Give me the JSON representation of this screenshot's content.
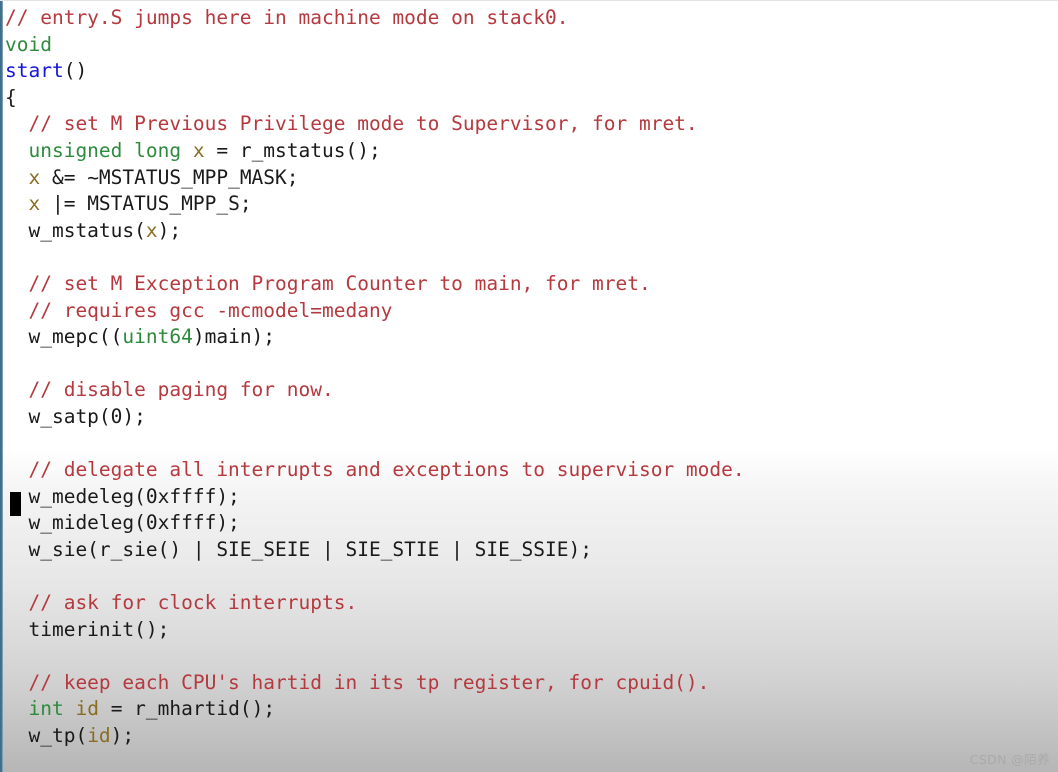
{
  "editor": {
    "language": "C",
    "colors": {
      "comment": "#b5393f",
      "type_keyword": "#2e8b3e",
      "function_name": "#1414dc",
      "variable": "#8a6d23",
      "plain_text": "#1a1a1a",
      "background_top": "#ffffff",
      "background_bottom": "#b6b6b6",
      "left_border": "#3d6b8a",
      "cursor": "#000000"
    },
    "cursor": {
      "shape": "block",
      "line_index": 18,
      "column": 0
    },
    "lines": [
      {
        "n": 1,
        "tokens": [
          {
            "t": "comment",
            "s": "// entry.S jumps here in machine mode on stack0."
          }
        ]
      },
      {
        "n": 2,
        "tokens": [
          {
            "t": "type",
            "s": "void"
          }
        ]
      },
      {
        "n": 3,
        "tokens": [
          {
            "t": "fn",
            "s": "start"
          },
          {
            "t": "plain",
            "s": "()"
          }
        ]
      },
      {
        "n": 4,
        "tokens": [
          {
            "t": "plain",
            "s": "{"
          }
        ]
      },
      {
        "n": 5,
        "tokens": [
          {
            "t": "comment",
            "s": "  // set M Previous Privilege mode to Supervisor, for mret."
          }
        ]
      },
      {
        "n": 6,
        "tokens": [
          {
            "t": "plain",
            "s": "  "
          },
          {
            "t": "type",
            "s": "unsigned long"
          },
          {
            "t": "plain",
            "s": " "
          },
          {
            "t": "var",
            "s": "x"
          },
          {
            "t": "plain",
            "s": " = r_mstatus();"
          }
        ]
      },
      {
        "n": 7,
        "tokens": [
          {
            "t": "plain",
            "s": "  "
          },
          {
            "t": "var",
            "s": "x"
          },
          {
            "t": "plain",
            "s": " &= ~MSTATUS_MPP_MASK;"
          }
        ]
      },
      {
        "n": 8,
        "tokens": [
          {
            "t": "plain",
            "s": "  "
          },
          {
            "t": "var",
            "s": "x"
          },
          {
            "t": "plain",
            "s": " |= MSTATUS_MPP_S;"
          }
        ]
      },
      {
        "n": 9,
        "tokens": [
          {
            "t": "plain",
            "s": "  w_mstatus("
          },
          {
            "t": "var",
            "s": "x"
          },
          {
            "t": "plain",
            "s": ");"
          }
        ]
      },
      {
        "n": 10,
        "tokens": [
          {
            "t": "plain",
            "s": ""
          }
        ]
      },
      {
        "n": 11,
        "tokens": [
          {
            "t": "comment",
            "s": "  // set M Exception Program Counter to main, for mret."
          }
        ]
      },
      {
        "n": 12,
        "tokens": [
          {
            "t": "comment",
            "s": "  // requires gcc -mcmodel=medany"
          }
        ]
      },
      {
        "n": 13,
        "tokens": [
          {
            "t": "plain",
            "s": "  w_mepc(("
          },
          {
            "t": "type",
            "s": "uint64"
          },
          {
            "t": "plain",
            "s": ")main);"
          }
        ]
      },
      {
        "n": 14,
        "tokens": [
          {
            "t": "plain",
            "s": ""
          }
        ]
      },
      {
        "n": 15,
        "tokens": [
          {
            "t": "comment",
            "s": "  // disable paging for now."
          }
        ]
      },
      {
        "n": 16,
        "tokens": [
          {
            "t": "plain",
            "s": "  w_satp(0);"
          }
        ]
      },
      {
        "n": 17,
        "tokens": [
          {
            "t": "plain",
            "s": ""
          }
        ]
      },
      {
        "n": 18,
        "tokens": [
          {
            "t": "comment",
            "s": "  // delegate all interrupts and exceptions to supervisor mode."
          }
        ]
      },
      {
        "n": 19,
        "tokens": [
          {
            "t": "plain",
            "s": "  w_medeleg(0xffff);"
          }
        ]
      },
      {
        "n": 20,
        "tokens": [
          {
            "t": "plain",
            "s": "  w_mideleg(0xffff);"
          }
        ]
      },
      {
        "n": 21,
        "tokens": [
          {
            "t": "plain",
            "s": "  w_sie(r_sie() | SIE_SEIE | SIE_STIE | SIE_SSIE);"
          }
        ]
      },
      {
        "n": 22,
        "tokens": [
          {
            "t": "plain",
            "s": ""
          }
        ]
      },
      {
        "n": 23,
        "tokens": [
          {
            "t": "comment",
            "s": "  // ask for clock interrupts."
          }
        ]
      },
      {
        "n": 24,
        "tokens": [
          {
            "t": "plain",
            "s": "  timerinit();"
          }
        ]
      },
      {
        "n": 25,
        "tokens": [
          {
            "t": "plain",
            "s": ""
          }
        ]
      },
      {
        "n": 26,
        "tokens": [
          {
            "t": "comment",
            "s": "  // keep each CPU's hartid in its tp register, for cpuid()."
          }
        ]
      },
      {
        "n": 27,
        "tokens": [
          {
            "t": "plain",
            "s": "  "
          },
          {
            "t": "type",
            "s": "int"
          },
          {
            "t": "plain",
            "s": " "
          },
          {
            "t": "var",
            "s": "id"
          },
          {
            "t": "plain",
            "s": " = r_mhartid();"
          }
        ]
      },
      {
        "n": 28,
        "tokens": [
          {
            "t": "plain",
            "s": "  w_tp("
          },
          {
            "t": "var",
            "s": "id"
          },
          {
            "t": "plain",
            "s": ");"
          }
        ]
      }
    ]
  },
  "watermark": {
    "text": "CSDN @陌养"
  }
}
